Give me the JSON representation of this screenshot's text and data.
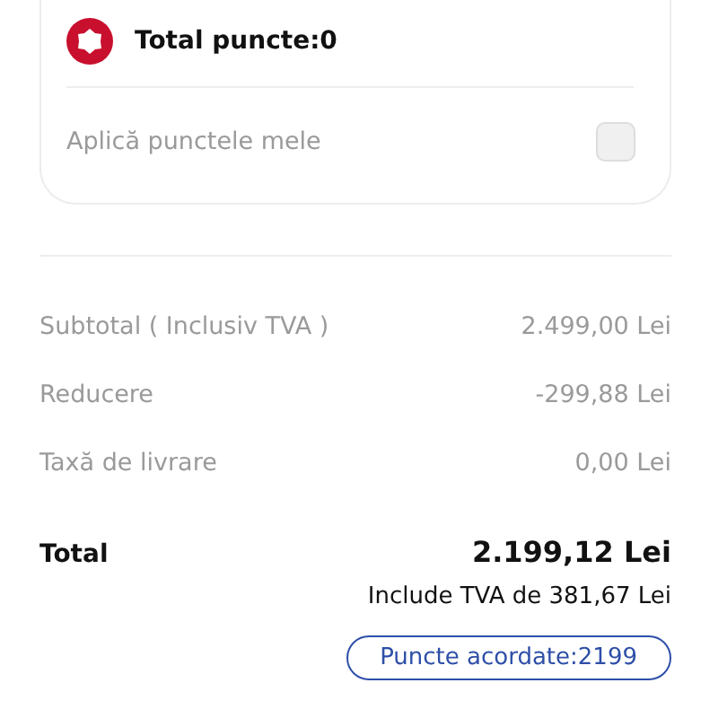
{
  "points_card": {
    "title": "Total puncte:0",
    "apply_label": "Aplică punctele mele",
    "apply_checked": false
  },
  "summary_rows": [
    {
      "label": "Subtotal ( Inclusiv TVA )",
      "value": "2.499,00 Lei"
    },
    {
      "label": "Reducere",
      "value": "-299,88 Lei"
    },
    {
      "label": "Taxă de livrare",
      "value": "0,00 Lei"
    }
  ],
  "total": {
    "label": "Total",
    "value": "2.199,12 Lei",
    "vat_note": "Include TVA de 381,67 Lei",
    "points_badge": "Puncte acordate:2199"
  }
}
